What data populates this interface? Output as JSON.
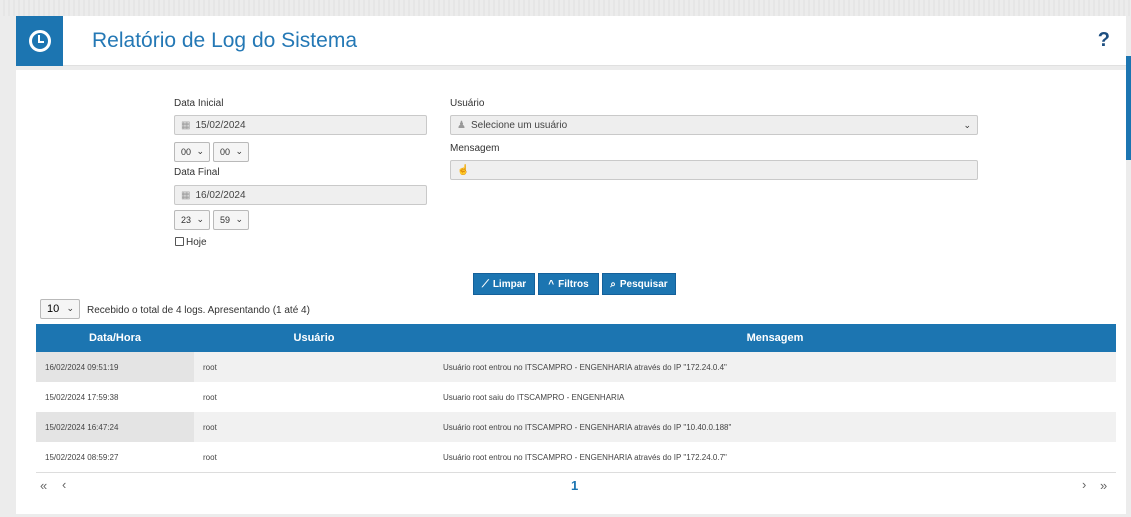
{
  "header": {
    "title": "Relatório de Log do Sistema",
    "help": "?",
    "icon": "clock-icon"
  },
  "form": {
    "data_inicial_label": "Data Inicial",
    "data_inicial_value": "15/02/2024",
    "hora_inicial": "00",
    "min_inicial": "00",
    "data_final_label": "Data Final",
    "data_final_value": "16/02/2024",
    "hora_final": "23",
    "min_final": "59",
    "hoje_label": "Hoje",
    "usuario_label": "Usuário",
    "usuario_value": "Selecione um usuário",
    "mensagem_label": "Mensagem",
    "mensagem_value": ""
  },
  "buttons": {
    "limpar": "Limpar",
    "filtros": "Filtros",
    "pesquisar": "Pesquisar"
  },
  "table": {
    "page_length": "10",
    "info": "Recebido o total de 4 logs. Apresentando (1 até 4)",
    "headers": [
      "Data/Hora",
      "Usuário",
      "Mensagem"
    ],
    "rows": [
      [
        "16/02/2024 09:51:19",
        "root",
        "Usuário root entrou no ITSCAMPRO - ENGENHARIA através do IP \"172.24.0.4\""
      ],
      [
        "15/02/2024 17:59:38",
        "root",
        "Usuario root saiu do ITSCAMPRO - ENGENHARIA"
      ],
      [
        "15/02/2024 16:47:24",
        "root",
        "Usuário root entrou no ITSCAMPRO - ENGENHARIA através do IP \"10.40.0.188\""
      ],
      [
        "15/02/2024 08:59:27",
        "root",
        "Usuário root entrou no ITSCAMPRO - ENGENHARIA através do IP \"172.24.0.7\""
      ]
    ]
  },
  "pager": {
    "first": "«",
    "prev": "‹",
    "page": "1",
    "next": "›",
    "last": "»"
  },
  "colors": {
    "accent": "#1c75b1"
  }
}
